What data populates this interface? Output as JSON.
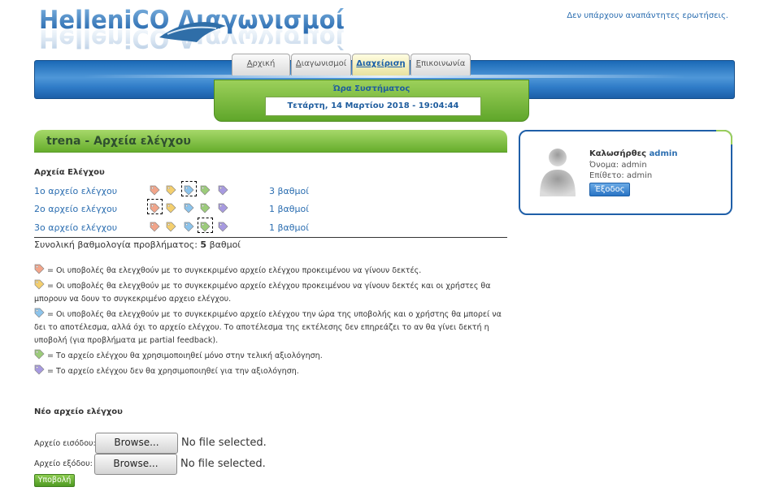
{
  "header": {
    "logo_text": "HelleniCO Διαγωνισμοί",
    "notice": "Δεν υπάρχουν αναπάντητες ερωτήσεις."
  },
  "nav": {
    "tabs": [
      {
        "label": "Αρχική",
        "access": "Α",
        "rest": "ρχική",
        "active": false
      },
      {
        "label": "Διαγωνισμοί",
        "access": "Δ",
        "rest": "ιαγωνισμοί",
        "active": false
      },
      {
        "label": "Διαχείριση",
        "access": "Δ",
        "rest": "ιαχείριση",
        "active": true
      },
      {
        "label": "Επικοινωνία",
        "access": "Ε",
        "rest": "πικοινωνία",
        "active": false
      }
    ]
  },
  "clock": {
    "label": "Ώρα Συστήματος",
    "value": "Τετάρτη, 14 Μαρτίου 2018 - 19:04:44"
  },
  "panel": {
    "title": "trena - Αρχεία ελέγχου",
    "files_heading": "Αρχεία Ελέγχου",
    "files": [
      {
        "name": "1ο αρχείο ελέγχου",
        "points": "3 βαθμοί",
        "selected_tag": 2
      },
      {
        "name": "2ο αρχείο ελέγχου",
        "points": "1 βαθμοί",
        "selected_tag": 0
      },
      {
        "name": "3ο αρχείο ελέγχου",
        "points": "1 βαθμοί",
        "selected_tag": 3
      }
    ],
    "total_prefix": "Συνολική βαθμολογία προβλήματος:",
    "total_value": "5",
    "total_suffix": "βαθμοί",
    "tag_colors": [
      "#f2a58a",
      "#f4cf6e",
      "#8cc4ec",
      "#9ccc7a",
      "#a79ae0"
    ],
    "legend": [
      "= Οι υποβολές θα ελεγχθούν με το συγκεκριμένο αρχείο ελέγχου προκειμένου να γίνουν δεκτές.",
      "= Οι υποβολές θα ελεγχθούν με το συγκεκριμένο αρχείο ελέγχου προκειμένου να γίνουν δεκτές και οι χρήστες θα μπορουν να δουν το συγκεκριμένο αρχειο ελέγχου.",
      "= Οι υποβολές θα ελεγχθούν με το συγκεκριμένο αρχείο ελέγχου την ώρα της υποβολής και ο χρήστης θα μπορεί να δει το αποτέλεσμα, αλλά όχι το αρχείο ελέγχου. Το αποτέλεσμα της εκτέλεσης δεν επηρεάζει το αν θα γίνει δεκτή η υποβολή (για προβλήματα με partial feedback).",
      "= Το αρχείο ελέγχου θα χρησιμοποιηθεί μόνο στην τελική αξιολόγηση.",
      "= Το αρχείο ελέγχου δεν θα χρησιμοποιηθεί για την αξιολόγηση."
    ],
    "new_heading": "Νέο αρχείο ελέγχου",
    "input_label": "Αρχείο εισόδου:",
    "output_label": "Αρχείο εξόδου:",
    "browse_label": "Browse...",
    "no_file": "No file selected.",
    "submit_label": "Υποβολή"
  },
  "user": {
    "greeting": "Καλωσήρθες",
    "username": "admin",
    "name_line": "Όνομα: admin",
    "surname_line": "Επίθετο: admin",
    "logout_label": "Έξοδος"
  }
}
